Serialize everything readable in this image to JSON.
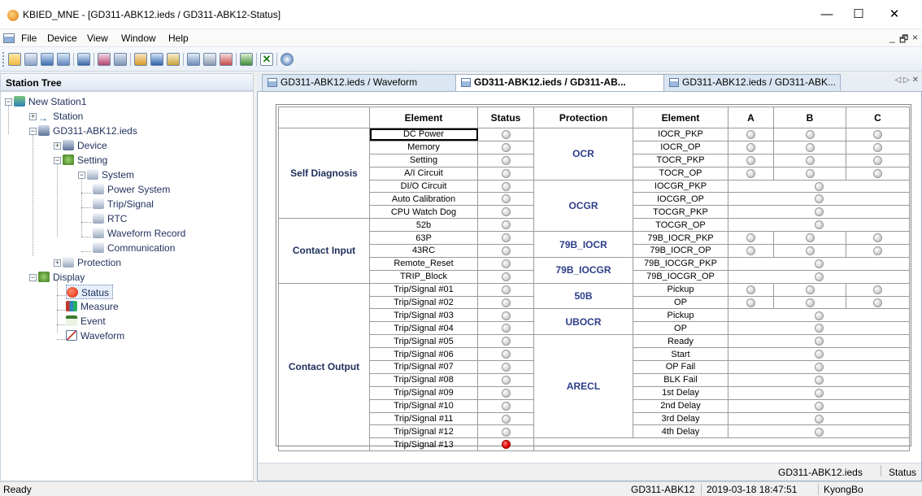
{
  "window": {
    "title": "KBIED_MNE - [GD311-ABK12.ieds / GD311-ABK12-Status]",
    "minimize": "—",
    "maximize": "☐",
    "close": "✕"
  },
  "menu": {
    "items": [
      "File",
      "Device",
      "View",
      "Window",
      "Help"
    ],
    "mdi_min": "_",
    "mdi_restore": "🗗",
    "mdi_close": "×"
  },
  "toolbar": {
    "icons": [
      "open-icon",
      "save-icon",
      "device-icon",
      "network-icon",
      "settings-icon",
      "connect-icon",
      "disconnect-icon",
      "config-icon",
      "monitor-icon",
      "display-icon",
      "window-icon",
      "tile-icon",
      "cascade-icon",
      "upload-icon",
      "cancel-icon",
      "help-icon"
    ]
  },
  "tree": {
    "header": "Station Tree",
    "nodes": [
      "New Station1",
      "Station",
      "GD311-ABK12.ieds",
      "Device",
      "Setting",
      "System",
      "Power System",
      "Trip/Signal",
      "RTC",
      "Waveform Record",
      "Communication",
      "Protection",
      "Display",
      "Status",
      "Measure",
      "Event",
      "Waveform"
    ]
  },
  "tabs": [
    {
      "label": "GD311-ABK12.ieds / Waveform"
    },
    {
      "label": "GD311-ABK12.ieds / GD311-AB..."
    },
    {
      "label": "GD311-ABK12.ieds / GD311-ABK..."
    }
  ],
  "tab_nav": "◁ ▷ ✕",
  "status_table": {
    "headers": [
      "Element",
      "Status",
      "Protection",
      "Element",
      "A",
      "B",
      "C"
    ],
    "groups": [
      "Self Diagnosis",
      "Contact Input",
      "Contact Output"
    ],
    "left_rows": [
      {
        "element": "DC Power",
        "on": false
      },
      {
        "element": "Memory",
        "on": false
      },
      {
        "element": "Setting",
        "on": false
      },
      {
        "element": "A/I Circuit",
        "on": false
      },
      {
        "element": "DI/O Circuit",
        "on": false
      },
      {
        "element": "Auto Calibration",
        "on": false
      },
      {
        "element": "CPU Watch Dog",
        "on": false
      },
      {
        "element": "52b",
        "on": false
      },
      {
        "element": "63P",
        "on": false
      },
      {
        "element": "43RC",
        "on": false
      },
      {
        "element": "Remote_Reset",
        "on": false
      },
      {
        "element": "TRIP_Block",
        "on": false
      },
      {
        "element": "Trip/Signal #01",
        "on": false
      },
      {
        "element": "Trip/Signal #02",
        "on": false
      },
      {
        "element": "Trip/Signal #03",
        "on": false
      },
      {
        "element": "Trip/Signal #04",
        "on": false
      },
      {
        "element": "Trip/Signal #05",
        "on": false
      },
      {
        "element": "Trip/Signal #06",
        "on": false
      },
      {
        "element": "Trip/Signal #07",
        "on": false
      },
      {
        "element": "Trip/Signal #08",
        "on": false
      },
      {
        "element": "Trip/Signal #09",
        "on": false
      },
      {
        "element": "Trip/Signal #10",
        "on": false
      },
      {
        "element": "Trip/Signal #11",
        "on": false
      },
      {
        "element": "Trip/Signal #12",
        "on": false
      },
      {
        "element": "Trip/Signal #13",
        "on": true
      }
    ],
    "protections": [
      "OCR",
      "OCGR",
      "79B_IOCR",
      "79B_IOCGR",
      "50B",
      "UBOCR",
      "ARECL"
    ],
    "right_rows": [
      "IOCR_PKP",
      "IOCR_OP",
      "TOCR_PKP",
      "TOCR_OP",
      "IOCGR_PKP",
      "IOCGR_OP",
      "TOCGR_PKP",
      "TOCGR_OP",
      "79B_IOCR_PKP",
      "79B_IOCR_OP",
      "79B_IOCGR_PKP",
      "79B_IOCGR_OP",
      "Pickup",
      "OP",
      "Pickup",
      "OP",
      "Ready",
      "Start",
      "OP Fail",
      "BLK Fail",
      "1st Delay",
      "2nd Delay",
      "3rd Delay",
      "4th Delay"
    ]
  },
  "doc_status": {
    "file": "GD311-ABK12.ieds",
    "mode": "Status"
  },
  "statusbar": {
    "left": "Ready",
    "device": "GD311-ABK12",
    "datetime": "2019-03-18 18:47:51",
    "user": "KyongBo"
  },
  "colors": {
    "led_on": "#e00000",
    "led_off": "#d2d2d2",
    "accent": "#2d3e8a"
  }
}
